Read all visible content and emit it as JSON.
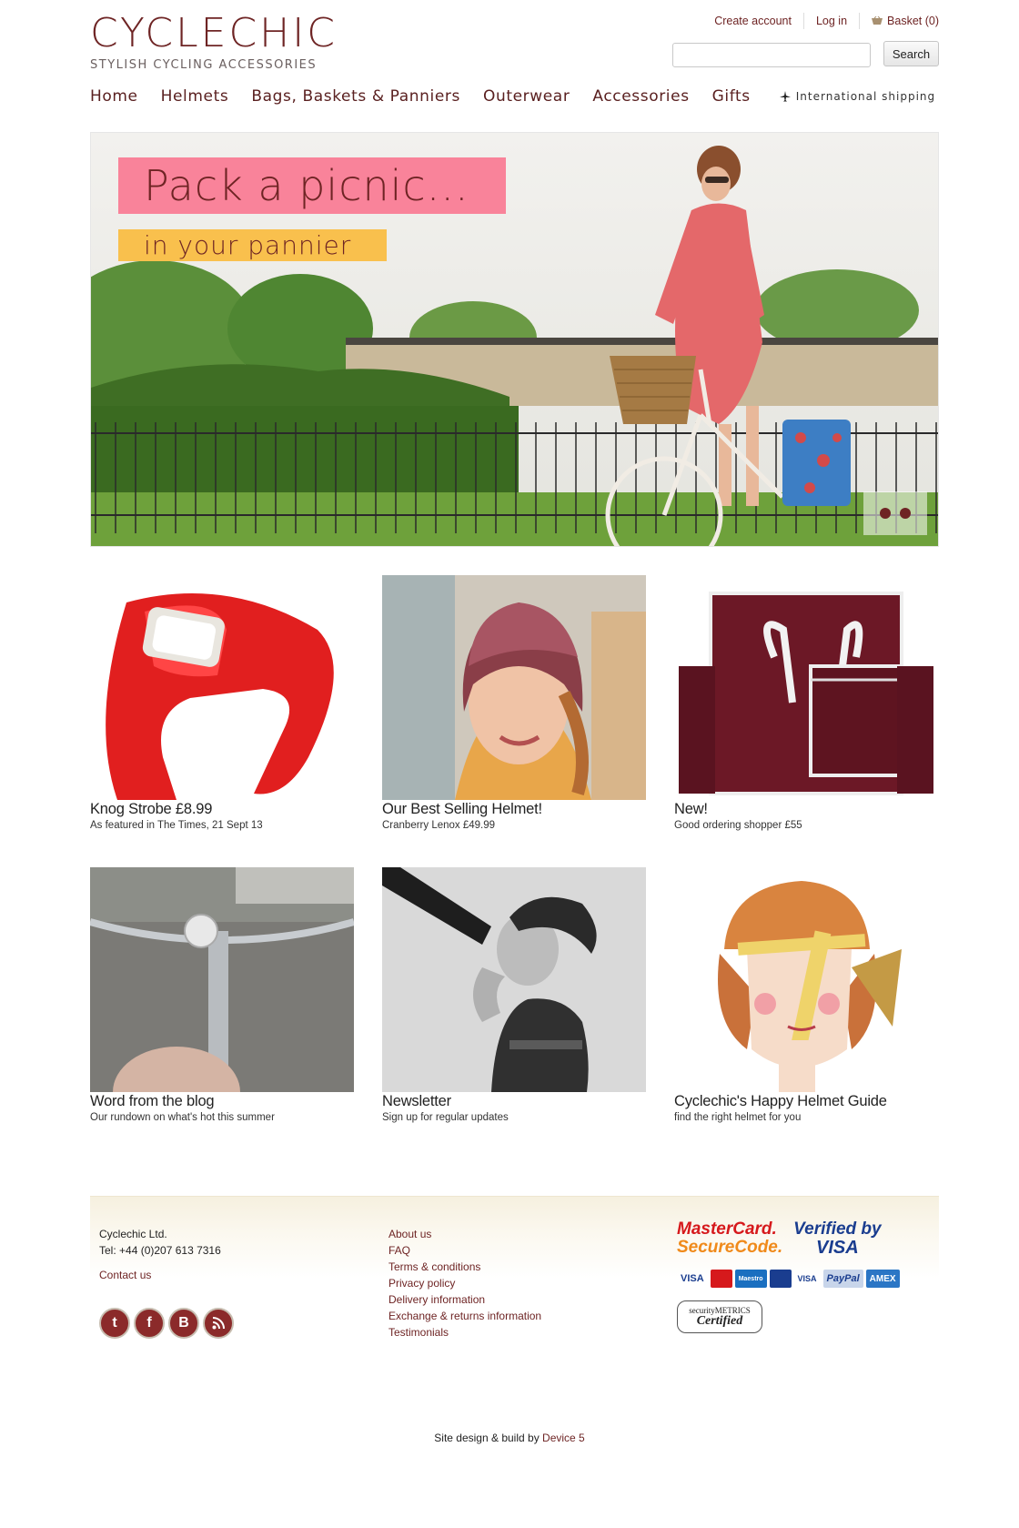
{
  "brand": {
    "name": "CYCLECHIC",
    "tagline": "STYLISH CYCLING ACCESSORIES",
    "color": "#6e2424"
  },
  "toplinks": {
    "create_account": "Create account",
    "login": "Log in",
    "basket": "Basket (0)"
  },
  "search": {
    "placeholder": "",
    "button": "Search"
  },
  "nav": {
    "items": [
      "Home",
      "Helmets",
      "Bags, Baskets & Panniers",
      "Outerwear",
      "Accessories",
      "Gifts"
    ],
    "intl": "International shipping"
  },
  "hero": {
    "headline": "Pack a picnic...",
    "subline": "in your pannier",
    "slide_count": 2
  },
  "tiles": [
    {
      "title": "Knog Strobe £8.99",
      "sub": "As featured in The Times, 21 Sept 13"
    },
    {
      "title": "Our Best Selling Helmet!",
      "sub": "Cranberry Lenox £49.99"
    },
    {
      "title": "New!",
      "sub": "Good ordering shopper £55"
    },
    {
      "title": "Word from the blog",
      "sub": "Our rundown on what's hot this summer"
    },
    {
      "title": "Newsletter",
      "sub": "Sign up for regular updates"
    },
    {
      "title": "Cyclechic's Happy Helmet Guide",
      "sub": "find the right helmet for you"
    }
  ],
  "footer": {
    "company": "Cyclechic Ltd.",
    "tel": "Tel: +44 (0)207 613 7316",
    "contact": "Contact us",
    "links": [
      "About us",
      "FAQ",
      "Terms & conditions",
      "Privacy policy",
      "Delivery information",
      "Exchange & returns information",
      "Testimonials"
    ],
    "social": [
      "twitter-icon",
      "facebook-icon",
      "blogger-icon",
      "rss-icon"
    ],
    "payment": {
      "mastercard_line1": "MasterCard.",
      "mastercard_line2": "SecureCode.",
      "visa_line1": "Verified by",
      "visa_line2": "VISA",
      "cards": [
        "VISA",
        "",
        "Maestro",
        "",
        "VISA",
        "PayPal",
        "AMEX"
      ],
      "secmet_line1": "securityMETRICS",
      "secmet_line2": "Certified"
    }
  },
  "credit": {
    "text": "Site design & build by ",
    "link": "Device 5"
  }
}
